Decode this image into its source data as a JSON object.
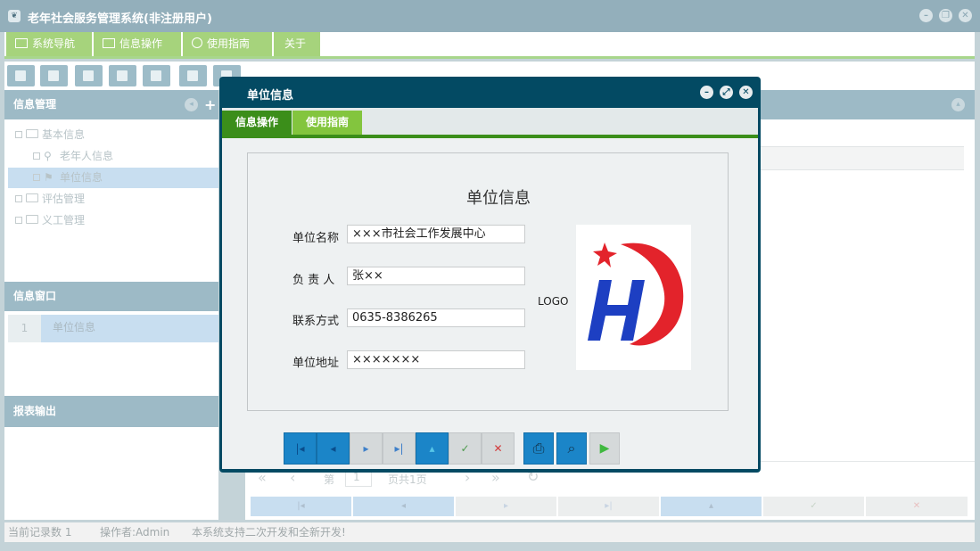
{
  "app": {
    "title": "老年社会服务管理系统(非注册用户)",
    "logo_glyph": "❦"
  },
  "menu": {
    "tabs": [
      {
        "label": "系统导航"
      },
      {
        "label": "信息操作"
      },
      {
        "label": "使用指南"
      },
      {
        "label": "关于"
      }
    ]
  },
  "left": {
    "info_mgmt_title": "信息管理",
    "tree": [
      {
        "label": "基本信息"
      },
      {
        "label": "老年人信息"
      },
      {
        "label": "单位信息"
      },
      {
        "label": "评估管理"
      },
      {
        "label": "义工管理"
      }
    ],
    "info_window_title": "信息窗口",
    "window_row": {
      "index": "1",
      "label": "单位信息"
    },
    "report_title": "报表输出"
  },
  "pager": {
    "page_prefix": "第",
    "page_value": "1",
    "page_suffix": "页共1页"
  },
  "status": {
    "record_count": "当前记录数 1",
    "operator": "操作者:Admin",
    "notice": "本系统支持二次开发和全新开发!"
  },
  "modal": {
    "title": "单位信息",
    "tabs": [
      {
        "label": "信息操作",
        "color": "#3b8e1a"
      },
      {
        "label": "使用指南",
        "color": "#83c53e"
      }
    ],
    "form_title": "单位信息",
    "fields": [
      {
        "label": "单位名称",
        "value": "×××市社会工作发展中心"
      },
      {
        "label": "负 责 人",
        "value": "张××"
      },
      {
        "label": "联系方式",
        "value": "0635-8386265"
      },
      {
        "label": "单位地址",
        "value": "×××××××"
      }
    ],
    "logo_label": "LOGO",
    "logo_text": "HD",
    "nav_buttons": [
      {
        "glyph": "|◂",
        "name": "first"
      },
      {
        "glyph": "◂",
        "name": "prev"
      },
      {
        "glyph": "▸",
        "name": "next"
      },
      {
        "glyph": "▸|",
        "name": "last"
      },
      {
        "glyph": "▴",
        "name": "upload"
      },
      {
        "glyph": "✓",
        "name": "save"
      },
      {
        "glyph": "✕",
        "name": "cancel"
      },
      {
        "glyph": "⎙",
        "name": "print"
      },
      {
        "glyph": "⌕",
        "name": "preview"
      },
      {
        "glyph": "▶",
        "name": "run"
      }
    ]
  },
  "colors": {
    "accent_green": "#a6d37c",
    "panel_header": "#9dbac6",
    "modal_frame": "#034a63",
    "nav_blue": "#1b85c8"
  }
}
